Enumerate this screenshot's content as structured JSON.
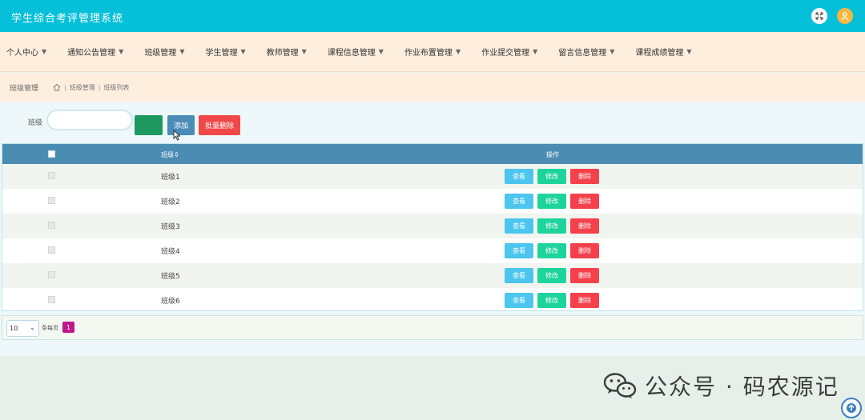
{
  "app": {
    "title": "学生综合考评管理系统"
  },
  "nav": [
    {
      "label": "个人中心"
    },
    {
      "label": "通知公告管理"
    },
    {
      "label": "班级管理"
    },
    {
      "label": "学生管理"
    },
    {
      "label": "教师管理"
    },
    {
      "label": "课程信息管理"
    },
    {
      "label": "作业布置管理"
    },
    {
      "label": "作业提交管理"
    },
    {
      "label": "留言信息管理"
    },
    {
      "label": "课程成绩管理"
    }
  ],
  "breadcrumb": {
    "title": "班级管理",
    "path": [
      "班级管理",
      "班级列表"
    ]
  },
  "filter": {
    "label": "班级",
    "value": "",
    "search_label": "",
    "add_label": "添加",
    "batch_delete_label": "批量删除"
  },
  "table": {
    "columns": {
      "name": "班级⇕",
      "actions": "操作"
    },
    "rows": [
      {
        "name": "班级1"
      },
      {
        "name": "班级2"
      },
      {
        "name": "班级3"
      },
      {
        "name": "班级4"
      },
      {
        "name": "班级5"
      },
      {
        "name": "班级6"
      }
    ],
    "actions": {
      "view": "查看",
      "edit": "修改",
      "delete": "删除"
    }
  },
  "pagination": {
    "page_size": "10",
    "per_page_text": "条每页",
    "current_page": "1"
  },
  "watermark": {
    "text": "公众号 · 码农源记"
  },
  "icons": {
    "fullscreen": "fullscreen-icon",
    "user": "user-icon",
    "home": "home-icon",
    "caret": "caret-down-icon",
    "back_to_top": "arrow-up-icon",
    "wechat": "wechat-icon"
  },
  "colors": {
    "topbar": "#06c0da",
    "nav_bg": "#fdeedd",
    "table_header": "#4b8cb3",
    "search_btn": "#1e9a61",
    "add_btn": "#4a8cb7",
    "batch_delete_btn": "#f04848",
    "view_btn": "#4cc5ef",
    "edit_btn": "#1fd49c",
    "delete_btn": "#f5414c",
    "page_active": "#c0168b"
  }
}
